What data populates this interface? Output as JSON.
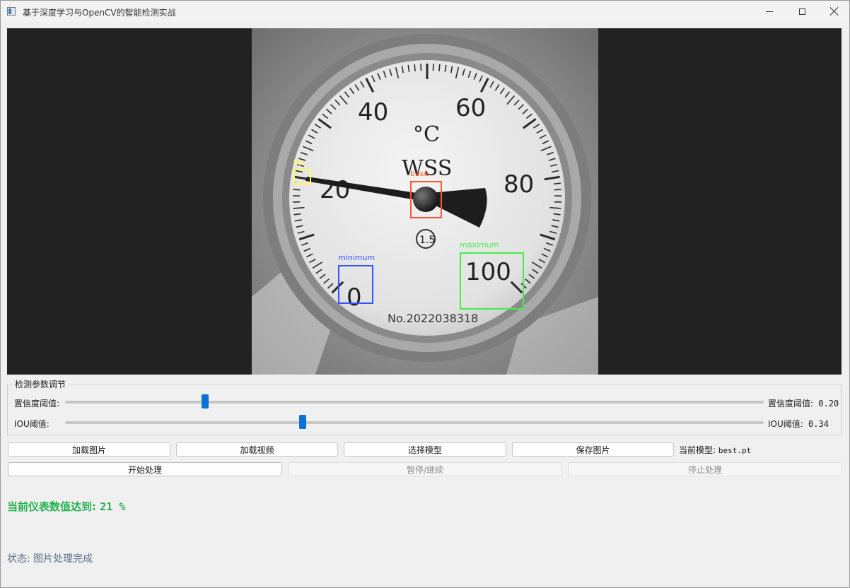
{
  "window": {
    "title": "基于深度学习与OpenCV的智能检测实战"
  },
  "detections": [
    {
      "label": "tip",
      "color": "#ffff55"
    },
    {
      "label": "base",
      "color": "#ff5533"
    },
    {
      "label": "minimum",
      "color": "#3355ff"
    },
    {
      "label": "maximum",
      "color": "#44ee44"
    }
  ],
  "gauge": {
    "scale_labels": [
      "0",
      "20",
      "40",
      "60",
      "80",
      "100"
    ],
    "unit": "°C",
    "brand": "WSS",
    "class_mark": "1.5",
    "serial": "No.2022038318"
  },
  "params": {
    "group_title": "检测参数调节",
    "confidence": {
      "label": "置信度阈值:",
      "value_label": "置信度阈值:",
      "value": "0.20",
      "fraction": 0.2
    },
    "iou": {
      "label": "IOU阈值:",
      "value_label": "IOU阈值:",
      "value": "0.34",
      "fraction": 0.34
    }
  },
  "toolbar": {
    "load_image": "加载图片",
    "load_video": "加载视频",
    "select_model": "选择模型",
    "save_image": "保存图片",
    "model_label": "当前模型:",
    "model_name": "best.pt",
    "start": "开始处理",
    "pause_resume": "暂停/继续",
    "stop": "停止处理"
  },
  "result": {
    "label": "当前仪表数值达到:",
    "value": "21 %",
    "color": "#22b14c"
  },
  "status": {
    "label": "状态:",
    "text": "图片处理完成"
  }
}
